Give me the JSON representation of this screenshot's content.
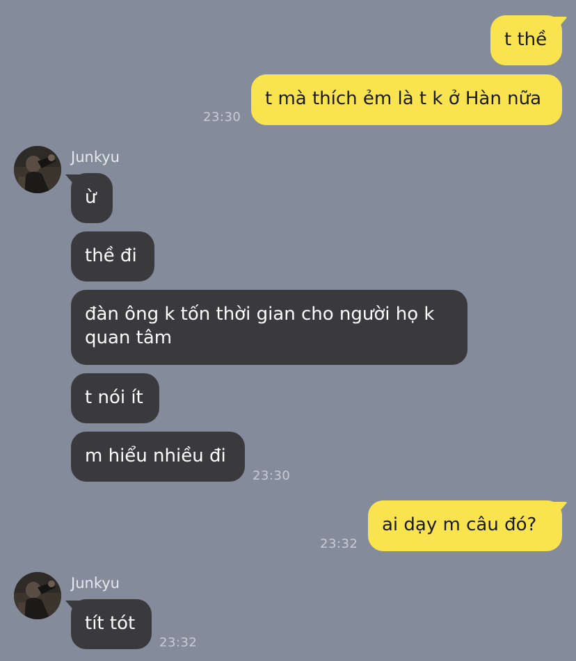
{
  "colors": {
    "background": "#848b9b",
    "outgoing_bubble": "#f9e450",
    "incoming_bubble": "#3a3a3d",
    "timestamp": "#c9ccd4"
  },
  "messages": {
    "out1": {
      "text": "t thề"
    },
    "out2": {
      "text": "t mà thích ẻm là t k ở Hàn nữa",
      "time": "23:30"
    },
    "group1": {
      "sender": "Junkyu",
      "avatar_icon": "avatar-photo-icon",
      "m1": "ừ",
      "m2": "thề đi",
      "m3": "đàn ông k tốn thời gian cho người họ k quan tâm",
      "m4": "t nói ít",
      "m5": "m hiểu nhiều đi",
      "time": "23:30"
    },
    "out3": {
      "text": "ai dạy m câu đó?",
      "time": "23:32"
    },
    "group2": {
      "sender": "Junkyu",
      "avatar_icon": "avatar-photo-icon",
      "m1": "tít tót",
      "time": "23:32"
    }
  }
}
